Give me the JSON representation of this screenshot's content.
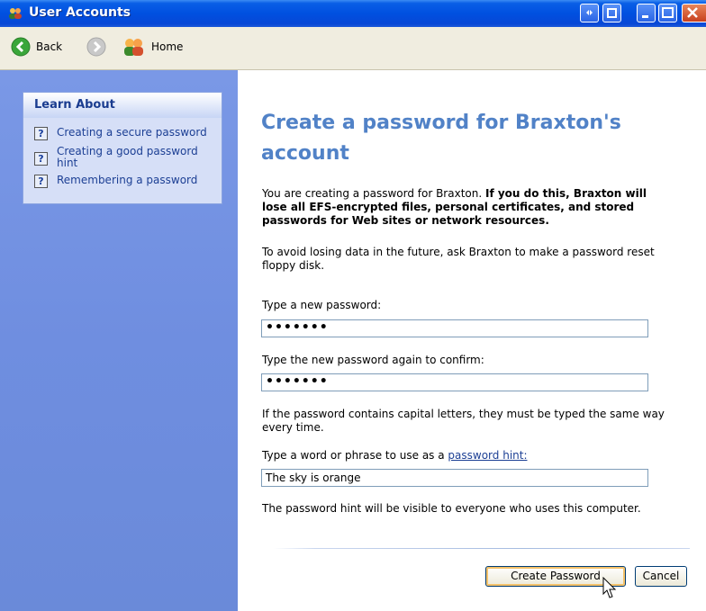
{
  "window": {
    "title": "User Accounts"
  },
  "toolbar": {
    "back_label": "Back",
    "home_label": "Home"
  },
  "learn_about": {
    "header": "Learn About",
    "items": [
      {
        "label": "Creating a secure password"
      },
      {
        "label": "Creating a good password hint"
      },
      {
        "label": "Remembering a password"
      }
    ]
  },
  "main": {
    "title": "Create a password for Braxton's account",
    "warning_prefix": "You are creating a password for Braxton.",
    "warning_bold": "If you do this, Braxton will lose all EFS-encrypted files, personal certificates, and stored passwords for Web sites or network resources.",
    "floppy_note": "To avoid losing data in the future, ask Braxton to make a password reset floppy disk.",
    "new_password_label": "Type a new password:",
    "new_password_value": "•••••••",
    "confirm_password_label": "Type the new password again to confirm:",
    "confirm_password_value": "•••••••",
    "caps_note": "If the password contains capital letters, they must be typed the same way every time.",
    "hint_label_prefix": "Type a word or phrase to use as a",
    "hint_link": "password hint:",
    "hint_value": "The sky is orange",
    "hint_visibility_note": "The password hint will be visible to everyone who uses this computer.",
    "create_button": "Create Password",
    "cancel_button": "Cancel"
  },
  "icons": {
    "title": "users-icon",
    "back": "back-arrow-icon",
    "forward": "forward-arrow-icon",
    "home": "users-home-icon",
    "help": "help-icon"
  },
  "colors": {
    "titlebar": "#0050e0",
    "heading": "#5182c7",
    "link": "#1c3f94",
    "sidebar": "#7a98e6"
  }
}
